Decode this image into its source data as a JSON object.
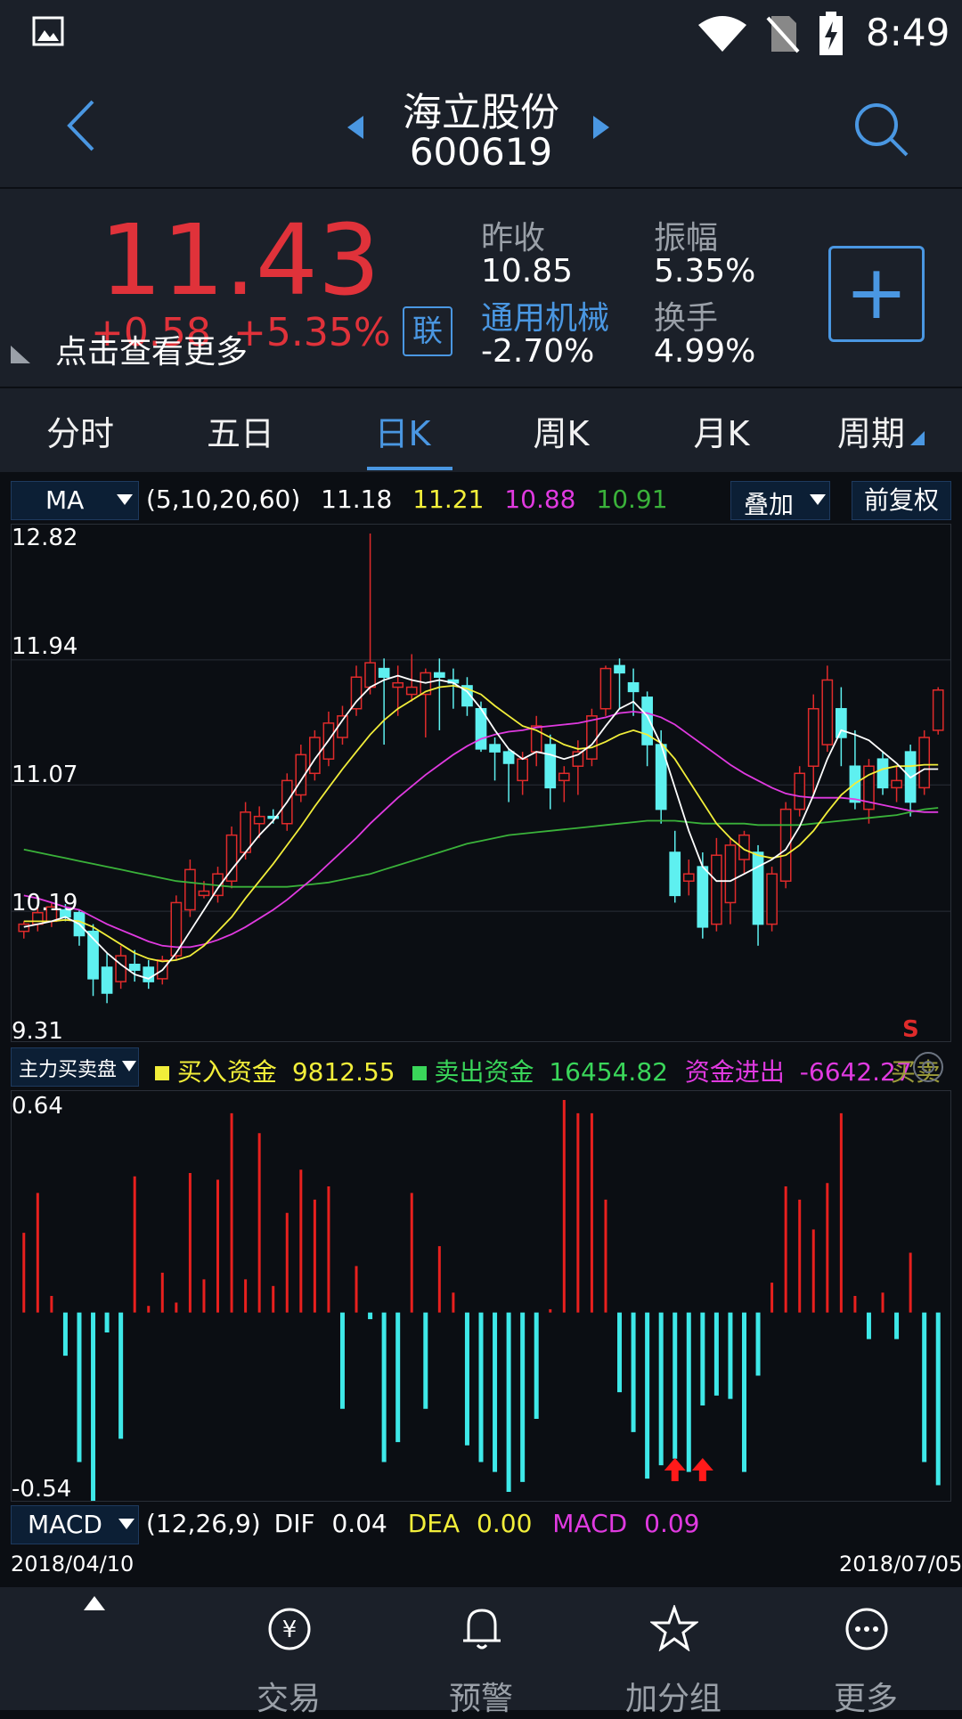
{
  "status": {
    "time": "8:49"
  },
  "header": {
    "name": "海立股份",
    "code": "600619"
  },
  "quote": {
    "price": "11.43",
    "change": "+0.58",
    "change_pct": "+5.35%",
    "overlay_hint": "点击查看更多",
    "link_badge": "联",
    "prev_close_label": "昨收",
    "prev_close": "10.85",
    "amplitude_label": "振幅",
    "amplitude": "5.35%",
    "sector": "通用机械",
    "sector_change": "-2.70%",
    "turnover_label": "换手",
    "turnover": "4.99%",
    "add_button": "+"
  },
  "tabs": [
    "分时",
    "五日",
    "日K",
    "周K",
    "月K",
    "周期"
  ],
  "ma_bar": {
    "name": "MA",
    "params": "(5,10,20,60)",
    "ma5": "11.18",
    "ma10": "11.21",
    "ma20": "10.88",
    "ma60": "10.91",
    "overlay": "叠加",
    "adjust": "前复权"
  },
  "flow_bar": {
    "name": "主力买卖盘",
    "buy_label": "买入资金",
    "buy_value": "9812.55",
    "sell_label": "卖出资金",
    "sell_value": "16454.82",
    "net_label": "资金进出",
    "net_value": "-6642.27",
    "extra": "买卖"
  },
  "macd_bar": {
    "name": "MACD",
    "params": "(12,26,9)",
    "dif_label": "DIF",
    "dif": "0.04",
    "dea_label": "DEA",
    "dea": "0.00",
    "macd_label": "MACD",
    "macd": "0.09"
  },
  "dates": {
    "start": "2018/04/10",
    "end": "2018/07/05"
  },
  "chart_data": [
    {
      "type": "candlestick",
      "y_ticks": [
        "12.82",
        "11.94",
        "11.07",
        "10.19",
        "9.31"
      ],
      "ylim": [
        9.31,
        12.82
      ],
      "signal_label": "S",
      "colors": {
        "up": "#e02b2b",
        "down": "#5ef0f0",
        "ma5": "#ffffff",
        "ma10": "#f2ee3a",
        "ma20": "#e03ae0",
        "ma60": "#3ab23a"
      },
      "candles": [
        [
          10.05,
          10.12,
          10.0,
          10.1
        ],
        [
          10.1,
          10.22,
          10.05,
          10.18
        ],
        [
          10.12,
          10.25,
          10.08,
          10.22
        ],
        [
          10.2,
          10.24,
          10.12,
          10.15
        ],
        [
          10.18,
          10.2,
          9.95,
          10.02
        ],
        [
          10.05,
          10.1,
          9.6,
          9.72
        ],
        [
          9.8,
          9.9,
          9.55,
          9.62
        ],
        [
          9.7,
          9.95,
          9.65,
          9.88
        ],
        [
          9.82,
          9.92,
          9.7,
          9.78
        ],
        [
          9.8,
          9.85,
          9.65,
          9.7
        ],
        [
          9.72,
          9.88,
          9.68,
          9.85
        ],
        [
          9.88,
          10.3,
          9.85,
          10.25
        ],
        [
          10.2,
          10.55,
          10.15,
          10.48
        ],
        [
          10.3,
          10.4,
          10.28,
          10.33
        ],
        [
          10.3,
          10.5,
          10.25,
          10.45
        ],
        [
          10.4,
          10.78,
          10.35,
          10.72
        ],
        [
          10.6,
          10.95,
          10.55,
          10.88
        ],
        [
          10.8,
          10.92,
          10.7,
          10.85
        ],
        [
          10.85,
          10.9,
          10.8,
          10.84
        ],
        [
          10.8,
          11.15,
          10.75,
          11.1
        ],
        [
          11.0,
          11.35,
          10.95,
          11.28
        ],
        [
          11.15,
          11.45,
          11.1,
          11.4
        ],
        [
          11.25,
          11.58,
          11.2,
          11.5
        ],
        [
          11.4,
          11.62,
          11.35,
          11.55
        ],
        [
          11.6,
          11.9,
          11.55,
          11.82
        ],
        [
          11.75,
          12.82,
          11.7,
          11.92
        ],
        [
          11.88,
          11.95,
          11.35,
          11.82
        ],
        [
          11.75,
          11.9,
          11.55,
          11.78
        ],
        [
          11.7,
          11.98,
          11.65,
          11.75
        ],
        [
          11.7,
          11.88,
          11.4,
          11.85
        ],
        [
          11.85,
          11.95,
          11.45,
          11.82
        ],
        [
          11.8,
          11.88,
          11.6,
          11.78
        ],
        [
          11.76,
          11.82,
          11.55,
          11.62
        ],
        [
          11.6,
          11.65,
          11.3,
          11.32
        ],
        [
          11.35,
          11.4,
          11.1,
          11.3
        ],
        [
          11.3,
          11.32,
          10.95,
          11.22
        ],
        [
          11.1,
          11.3,
          11.0,
          11.25
        ],
        [
          11.3,
          11.55,
          11.2,
          11.48
        ],
        [
          11.35,
          11.42,
          10.9,
          11.05
        ],
        [
          11.1,
          11.2,
          10.95,
          11.15
        ],
        [
          11.2,
          11.38,
          11.0,
          11.3
        ],
        [
          11.25,
          11.6,
          11.2,
          11.55
        ],
        [
          11.6,
          11.9,
          11.55,
          11.88
        ],
        [
          11.9,
          11.95,
          11.6,
          11.85
        ],
        [
          11.78,
          11.88,
          11.55,
          11.72
        ],
        [
          11.68,
          11.72,
          11.2,
          11.35
        ],
        [
          11.35,
          11.45,
          10.8,
          10.9
        ],
        [
          10.6,
          10.75,
          10.25,
          10.3
        ],
        [
          10.4,
          10.55,
          10.3,
          10.45
        ],
        [
          10.5,
          10.6,
          10.0,
          10.08
        ],
        [
          10.1,
          10.7,
          10.05,
          10.58
        ],
        [
          10.25,
          10.7,
          10.1,
          10.65
        ],
        [
          10.55,
          10.75,
          10.45,
          10.72
        ],
        [
          10.6,
          10.65,
          9.95,
          10.1
        ],
        [
          10.1,
          10.5,
          10.05,
          10.45
        ],
        [
          10.4,
          10.95,
          10.35,
          10.9
        ],
        [
          10.9,
          11.2,
          10.85,
          11.15
        ],
        [
          11.2,
          11.7,
          11.0,
          11.6
        ],
        [
          11.35,
          11.9,
          11.3,
          11.8
        ],
        [
          11.6,
          11.75,
          11.2,
          11.4
        ],
        [
          11.2,
          11.45,
          10.9,
          10.95
        ],
        [
          10.9,
          11.25,
          10.8,
          11.2
        ],
        [
          11.25,
          11.3,
          11.0,
          11.05
        ],
        [
          11.05,
          11.2,
          10.95,
          11.1
        ],
        [
          11.3,
          11.35,
          10.85,
          10.95
        ],
        [
          11.05,
          11.45,
          11.0,
          11.4
        ],
        [
          11.45,
          11.75,
          11.42,
          11.73
        ]
      ],
      "ma5": [
        10.08,
        10.1,
        10.12,
        10.15,
        10.1,
        10.0,
        9.9,
        9.82,
        9.75,
        9.72,
        9.78,
        9.9,
        10.05,
        10.2,
        10.35,
        10.48,
        10.6,
        10.72,
        10.82,
        10.95,
        11.1,
        11.25,
        11.38,
        11.52,
        11.65,
        11.75,
        11.8,
        11.83,
        11.8,
        11.78,
        11.8,
        11.78,
        11.72,
        11.6,
        11.45,
        11.32,
        11.25,
        11.3,
        11.28,
        11.25,
        11.28,
        11.35,
        11.48,
        11.6,
        11.65,
        11.55,
        11.35,
        11.05,
        10.75,
        10.5,
        10.4,
        10.4,
        10.45,
        10.5,
        10.55,
        10.62,
        10.78,
        11.0,
        11.25,
        11.45,
        11.42,
        11.38,
        11.3,
        11.22,
        11.12,
        11.18,
        11.18
      ],
      "ma10": [
        10.12,
        10.12,
        10.12,
        10.13,
        10.12,
        10.08,
        10.02,
        9.96,
        9.9,
        9.86,
        9.84,
        9.85,
        9.88,
        9.95,
        10.05,
        10.15,
        10.28,
        10.4,
        10.52,
        10.65,
        10.78,
        10.92,
        11.05,
        11.18,
        11.3,
        11.42,
        11.52,
        11.6,
        11.66,
        11.72,
        11.75,
        11.76,
        11.74,
        11.7,
        11.62,
        11.55,
        11.48,
        11.45,
        11.4,
        11.35,
        11.32,
        11.33,
        11.37,
        11.42,
        11.45,
        11.42,
        11.36,
        11.25,
        11.1,
        10.95,
        10.8,
        10.7,
        10.62,
        10.58,
        10.56,
        10.58,
        10.65,
        10.75,
        10.88,
        11.0,
        11.08,
        11.14,
        11.18,
        11.2,
        11.2,
        11.21,
        11.21
      ],
      "ma20": [
        10.3,
        10.28,
        10.25,
        10.22,
        10.2,
        10.15,
        10.1,
        10.06,
        10.02,
        9.98,
        9.95,
        9.94,
        9.94,
        9.96,
        9.99,
        10.03,
        10.08,
        10.14,
        10.2,
        10.27,
        10.35,
        10.43,
        10.52,
        10.61,
        10.7,
        10.8,
        10.89,
        10.98,
        11.06,
        11.14,
        11.21,
        11.28,
        11.34,
        11.39,
        11.42,
        11.44,
        11.45,
        11.47,
        11.48,
        11.49,
        11.5,
        11.52,
        11.54,
        11.57,
        11.58,
        11.57,
        11.54,
        11.49,
        11.42,
        11.35,
        11.28,
        11.21,
        11.15,
        11.1,
        11.05,
        11.01,
        10.99,
        10.98,
        10.98,
        10.98,
        10.97,
        10.95,
        10.93,
        10.91,
        10.89,
        10.88,
        10.88
      ],
      "ma60": [
        10.62,
        10.6,
        10.58,
        10.56,
        10.54,
        10.52,
        10.5,
        10.48,
        10.46,
        10.44,
        10.42,
        10.4,
        10.39,
        10.38,
        10.37,
        10.36,
        10.36,
        10.36,
        10.36,
        10.36,
        10.37,
        10.38,
        10.39,
        10.41,
        10.43,
        10.45,
        10.48,
        10.51,
        10.54,
        10.57,
        10.6,
        10.63,
        10.66,
        10.68,
        10.7,
        10.72,
        10.73,
        10.74,
        10.75,
        10.76,
        10.77,
        10.78,
        10.79,
        10.8,
        10.81,
        10.82,
        10.82,
        10.82,
        10.81,
        10.8,
        10.8,
        10.8,
        10.8,
        10.79,
        10.79,
        10.79,
        10.79,
        10.8,
        10.81,
        10.82,
        10.83,
        10.84,
        10.85,
        10.86,
        10.88,
        10.9,
        10.91
      ]
    },
    {
      "type": "bar",
      "y_ticks": [
        "0.64",
        "-0.54"
      ],
      "ylim": [
        -0.54,
        0.64
      ],
      "values": [
        0.24,
        0.36,
        0.05,
        -0.13,
        -0.45,
        -0.6,
        -0.06,
        -0.38,
        0.41,
        0.02,
        0.12,
        0.03,
        0.42,
        0.1,
        0.4,
        0.6,
        0.1,
        0.54,
        0.08,
        0.3,
        0.43,
        0.34,
        0.38,
        -0.29,
        0.14,
        -0.02,
        -0.45,
        -0.39,
        0.36,
        -0.29,
        0.2,
        0.06,
        -0.4,
        -0.45,
        -0.48,
        -0.54,
        -0.51,
        -0.32,
        0.01,
        0.64,
        0.6,
        0.6,
        0.34,
        -0.24,
        -0.36,
        -0.5,
        -0.46,
        -0.44,
        -0.48,
        -0.28,
        -0.25,
        -0.26,
        -0.48,
        -0.19,
        0.09,
        0.38,
        0.34,
        0.25,
        0.39,
        0.6,
        0.05,
        -0.08,
        0.06,
        -0.08,
        0.18,
        -0.45,
        -0.52
      ]
    },
    {
      "type": "annotation",
      "markers": [
        47,
        49
      ]
    }
  ]
}
